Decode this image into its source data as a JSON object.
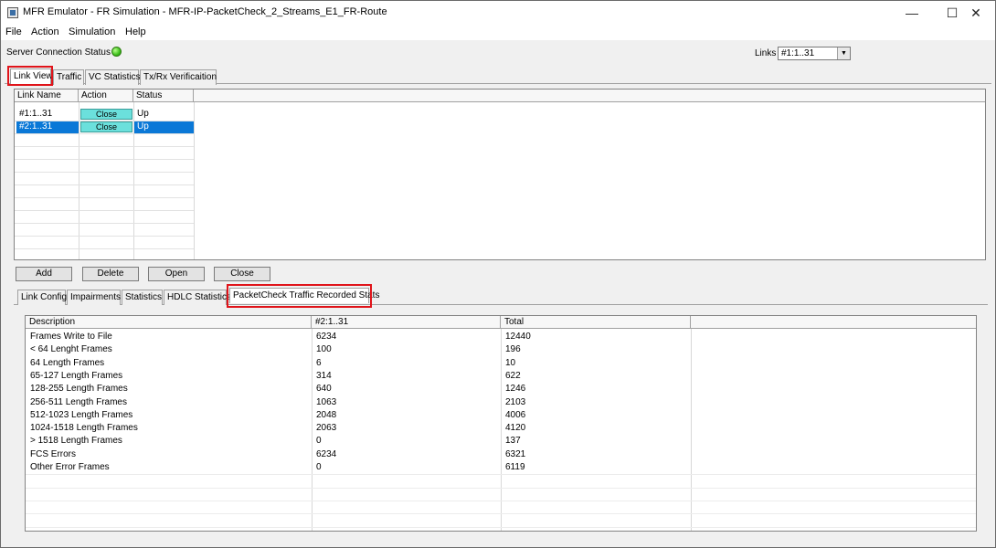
{
  "window": {
    "title": "MFR Emulator - FR Simulation - MFR-IP-PacketCheck_2_Streams_E1_FR-Route",
    "minimize": "—",
    "maximize": "☐",
    "close": "✕"
  },
  "menu": [
    "File",
    "Action",
    "Simulation",
    "Help"
  ],
  "server": {
    "label": "Server Connection Status",
    "status_color": "#3cbf1a"
  },
  "links": {
    "label": "Links",
    "selected": "#1:1..31",
    "arrow": "▼"
  },
  "top_tabs": [
    "Link View",
    "Traffic",
    "VC Statistics",
    "Tx/Rx Verificaition"
  ],
  "link_table": {
    "columns": [
      "Link Name",
      "Action",
      "Status"
    ],
    "rows": [
      {
        "name": "#1:1..31",
        "action": "Close",
        "status": "Up",
        "selected": false
      },
      {
        "name": "#2:1..31",
        "action": "Close",
        "status": "Up",
        "selected": true
      }
    ]
  },
  "buttons": [
    "Add",
    "Delete",
    "Open",
    "Close"
  ],
  "bottom_tabs": [
    "Link Config",
    "Impairments",
    "Statistics",
    "HDLC Statistics",
    "PacketCheck Traffic Recorded Stats"
  ],
  "stats_table": {
    "columns": [
      "Description",
      "#2:1..31",
      "Total"
    ],
    "rows": [
      [
        "Frames Write to File",
        "6234",
        "12440"
      ],
      [
        "< 64 Lenght Frames",
        "100",
        "196"
      ],
      [
        "64 Length Frames",
        "6",
        "10"
      ],
      [
        "65-127 Length Frames",
        "314",
        "622"
      ],
      [
        "128-255 Length Frames",
        "640",
        "1246"
      ],
      [
        "256-511 Length Frames",
        "1063",
        "2103"
      ],
      [
        "512-1023 Length Frames",
        "2048",
        "4006"
      ],
      [
        "1024-1518 Length Frames",
        "2063",
        "4120"
      ],
      [
        "> 1518 Length Frames",
        "0",
        "137"
      ],
      [
        "FCS Errors",
        "6234",
        "6321"
      ],
      [
        "Other Error Frames",
        "0",
        "6119"
      ]
    ]
  },
  "colors": {
    "highlight": "#e0141a",
    "selection": "#0a78d7",
    "action_cell": "#6be0dc"
  }
}
